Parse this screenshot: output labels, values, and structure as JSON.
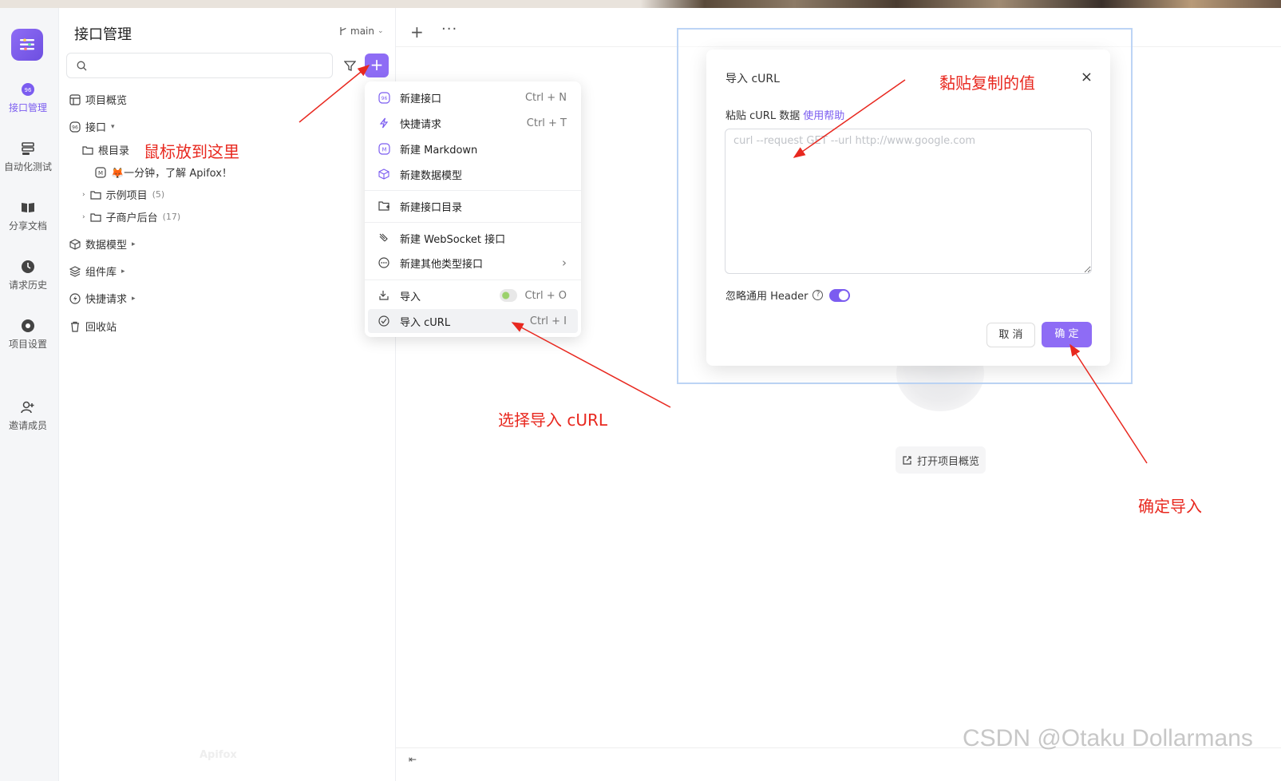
{
  "sidebar": {
    "title": "接口管理",
    "branch": "main",
    "search_placeholder": "",
    "tree": {
      "overview": "项目概览",
      "apis": "接口",
      "root_dir": "根目录",
      "quick_doc": "🦊一分钟，了解 Apifox！",
      "example": "示例项目",
      "example_count": "(5)",
      "merchant": "子商户后台",
      "merchant_count": "(17)",
      "schemas": "数据模型",
      "components": "组件库",
      "quick_requests": "快捷请求",
      "recycle": "回收站"
    },
    "watermark": "Apifox"
  },
  "rail": {
    "items": [
      {
        "label": "接口管理",
        "icon": "api-icon",
        "active": true
      },
      {
        "label": "自动化测试",
        "icon": "automation-icon"
      },
      {
        "label": "分享文档",
        "icon": "share-doc-icon"
      },
      {
        "label": "请求历史",
        "icon": "history-icon"
      },
      {
        "label": "项目设置",
        "icon": "settings-icon"
      },
      {
        "label": "邀请成员",
        "icon": "invite-member-icon"
      }
    ]
  },
  "menu": {
    "items": [
      {
        "label": "新建接口",
        "shortcut": "Ctrl + N",
        "icon": "api-icon"
      },
      {
        "label": "快捷请求",
        "shortcut": "Ctrl + T",
        "icon": "lightning-icon"
      },
      {
        "label": "新建 Markdown",
        "shortcut": "",
        "icon": "markdown-icon"
      },
      {
        "label": "新建数据模型",
        "shortcut": "",
        "icon": "cube-icon"
      },
      {
        "label": "新建接口目录",
        "shortcut": "",
        "icon": "folder-add-icon"
      },
      {
        "label": "新建 WebSocket 接口",
        "shortcut": "",
        "icon": "websocket-icon"
      },
      {
        "label": "新建其他类型接口",
        "shortcut": "",
        "icon": "more-circle-icon"
      },
      {
        "label": "导入",
        "shortcut": "Ctrl + O",
        "icon": "import-icon"
      },
      {
        "label": "导入 cURL",
        "shortcut": "Ctrl + I",
        "icon": "curl-icon"
      }
    ]
  },
  "main": {
    "open_overview": "打开项目概览"
  },
  "modal": {
    "title": "导入 cURL",
    "paste_label": "粘贴 cURL 数据",
    "help_link": "使用帮助",
    "placeholder": "curl --request GET --url http://www.google.com",
    "value": "",
    "ignore_header": "忽略通用 Header",
    "ignore_header_on": true,
    "cancel": "取 消",
    "ok": "确 定"
  },
  "annotations": {
    "hover_here": "鼠标放到这里",
    "paste_value": "黏贴复制的值",
    "select_import": "选择导入 cURL",
    "confirm_import": "确定导入"
  },
  "watermark": "CSDN @Otaku Dollarmans",
  "colors": {
    "accent": "#8e6cf5",
    "annotation": "#e8281f"
  }
}
